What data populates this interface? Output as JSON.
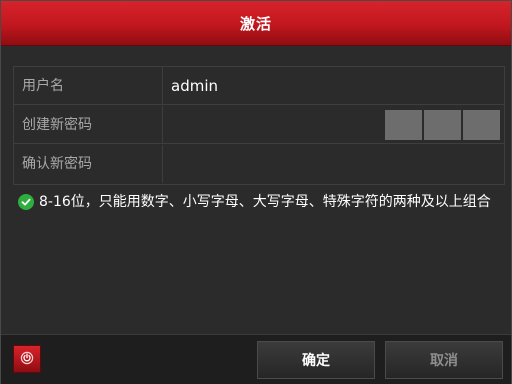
{
  "dialog": {
    "title": "激活"
  },
  "form": {
    "username_label": "用户名",
    "username_value": "admin",
    "new_password_label": "创建新密码",
    "confirm_password_label": "确认新密码",
    "strength_level": 0
  },
  "hint": {
    "icon": "check-circle-icon",
    "text": "8-16位，只能用数字、小写字母、大写字母、特殊字符的两种及以上组合"
  },
  "footer": {
    "power_icon": "power-icon",
    "ok_label": "确定",
    "cancel_label": "取消"
  },
  "colors": {
    "accent": "#c0171e",
    "check": "#2fae3f"
  }
}
